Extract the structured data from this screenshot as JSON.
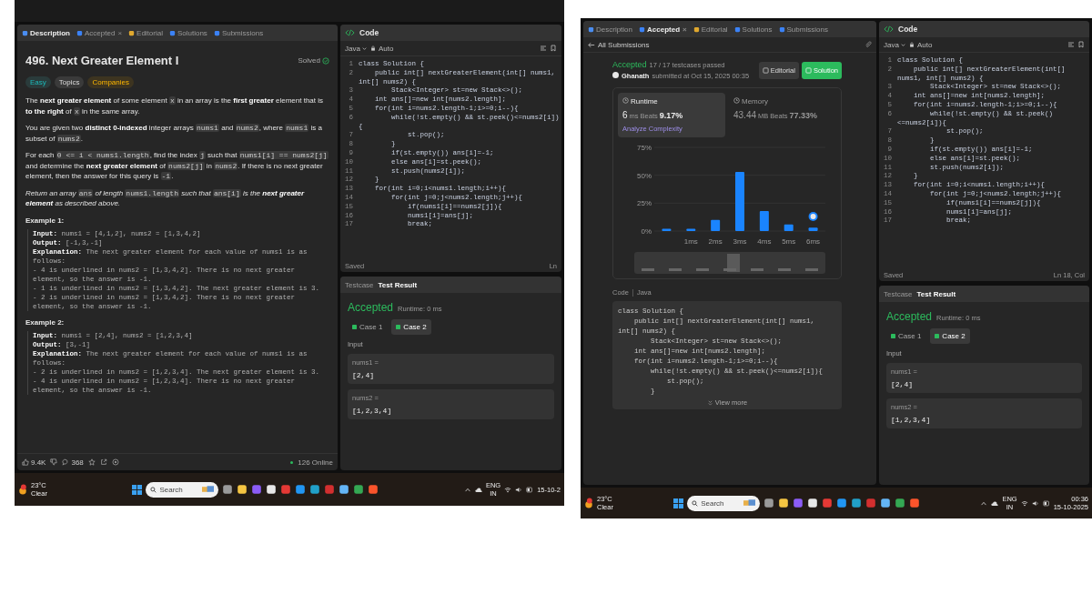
{
  "screenshots": [
    {
      "kind": "description",
      "tabs": [
        {
          "label": "Description",
          "selected": true
        },
        {
          "label": "Accepted",
          "selected": false,
          "close": "×"
        },
        {
          "label": "Editorial",
          "selected": false
        },
        {
          "label": "Solutions",
          "selected": false
        },
        {
          "label": "Submissions",
          "selected": false
        }
      ],
      "problem": {
        "title": "496. Next Greater Element I",
        "status": "Solved",
        "tags": [
          {
            "label": "Easy",
            "kind": "difficulty"
          },
          {
            "label": "Topics",
            "kind": "topics"
          },
          {
            "label": "Companies",
            "kind": "companies"
          }
        ],
        "paragraphs": [
          [
            {
              "kind": "text",
              "text": "The "
            },
            {
              "kind": "bold",
              "text": "next greater element"
            },
            {
              "kind": "text",
              "text": " of some element "
            },
            {
              "kind": "code",
              "text": "x"
            },
            {
              "kind": "text",
              "text": " in an array is the "
            },
            {
              "kind": "bold",
              "text": "first greater"
            },
            {
              "kind": "text",
              "text": " element that is "
            },
            {
              "kind": "bold",
              "text": "to the right"
            },
            {
              "kind": "text",
              "text": " of "
            },
            {
              "kind": "code",
              "text": "x"
            },
            {
              "kind": "text",
              "text": " in the same array."
            }
          ],
          [
            {
              "kind": "text",
              "text": "You are given two "
            },
            {
              "kind": "bold",
              "text": "distinct 0-indexed"
            },
            {
              "kind": "text",
              "text": " integer arrays "
            },
            {
              "kind": "code",
              "text": "nums1"
            },
            {
              "kind": "text",
              "text": " and "
            },
            {
              "kind": "code",
              "text": "nums2"
            },
            {
              "kind": "text",
              "text": ", where "
            },
            {
              "kind": "code",
              "text": "nums1"
            },
            {
              "kind": "text",
              "text": " is a subset of "
            },
            {
              "kind": "code",
              "text": "nums2"
            },
            {
              "kind": "text",
              "text": "."
            }
          ],
          [
            {
              "kind": "text",
              "text": "For each "
            },
            {
              "kind": "code",
              "text": "0 <= i < nums1.length"
            },
            {
              "kind": "text",
              "text": ", find the index "
            },
            {
              "kind": "code",
              "text": "j"
            },
            {
              "kind": "text",
              "text": " such that "
            },
            {
              "kind": "code",
              "text": "nums1[i] == nums2[j]"
            },
            {
              "kind": "text",
              "text": " and determine the "
            },
            {
              "kind": "bold",
              "text": "next greater element"
            },
            {
              "kind": "text",
              "text": " of "
            },
            {
              "kind": "code",
              "text": "nums2[j]"
            },
            {
              "kind": "text",
              "text": " in "
            },
            {
              "kind": "code",
              "text": "nums2"
            },
            {
              "kind": "text",
              "text": ". If there is no next greater element, then the answer for this query is "
            },
            {
              "kind": "code",
              "text": "-1"
            },
            {
              "kind": "text",
              "text": "."
            }
          ],
          [
            {
              "kind": "italic",
              "text": "Return an array "
            },
            {
              "kind": "code",
              "text": "ans"
            },
            {
              "kind": "italic",
              "text": " of length "
            },
            {
              "kind": "code",
              "text": "nums1.length"
            },
            {
              "kind": "italic",
              "text": " such that "
            },
            {
              "kind": "code",
              "text": "ans[i]"
            },
            {
              "kind": "italic",
              "text": " is the "
            },
            {
              "kind": "bolditalic",
              "text": "next greater element"
            },
            {
              "kind": "italic",
              "text": " as described above."
            }
          ]
        ],
        "examples": [
          {
            "title": "Example 1:",
            "lines": [
              {
                "label": "Input:",
                "text": " nums1 = [4,1,2], nums2 = [1,3,4,2]"
              },
              {
                "label": "Output:",
                "text": " [-1,3,-1]"
              },
              {
                "label": "Explanation:",
                "text": " The next greater element for each value of nums1 is as follows:"
              },
              {
                "text": "- 4 is underlined in nums2 = [1,3,4,2]. There is no next greater element, so the answer is -1."
              },
              {
                "text": "- 1 is underlined in nums2 = [1,3,4,2]. The next greater element is 3."
              },
              {
                "text": "- 2 is underlined in nums2 = [1,3,4,2]. There is no next greater element, so the answer is -1."
              }
            ]
          },
          {
            "title": "Example 2:",
            "lines": [
              {
                "label": "Input:",
                "text": " nums1 = [2,4], nums2 = [1,2,3,4]"
              },
              {
                "label": "Output:",
                "text": " [3,-1]"
              },
              {
                "label": "Explanation:",
                "text": " The next greater element for each value of nums1 is as follows:"
              },
              {
                "text": "- 2 is underlined in nums2 = [1,2,3,4]. The next greater element is 3."
              },
              {
                "text": "- 4 is underlined in nums2 = [1,2,3,4]. There is no next greater element, so the answer is -1."
              }
            ]
          }
        ],
        "likes": "9.4K",
        "comments": "368",
        "online": "126 Online"
      },
      "editor": {
        "title": "Code",
        "language": "Java",
        "mode": "Auto",
        "status": "Saved",
        "position": "Ln",
        "lines": [
          {
            "n": "1",
            "code": "class Solution {"
          },
          {
            "n": "2",
            "code": "    public int[] nextGreaterElement(int[] nums1, int[] nums2) {"
          },
          {
            "n": "3",
            "code": "        Stack<Integer> st=new Stack<>();"
          },
          {
            "n": "4",
            "code": "    int ans[]=new int[nums2.length];"
          },
          {
            "n": "5",
            "code": "    for(int i=nums2.length-1;i>=0;i--){"
          },
          {
            "n": "6",
            "code": "        while(!st.empty() && st.peek()<=nums2[i]){"
          },
          {
            "n": "7",
            "code": "            st.pop();"
          },
          {
            "n": "8",
            "code": "        }"
          },
          {
            "n": "9",
            "code": "        if(st.empty()) ans[i]=-1;"
          },
          {
            "n": "10",
            "code": "        else ans[i]=st.peek();"
          },
          {
            "n": "11",
            "code": "        st.push(nums2[i]);"
          },
          {
            "n": "12",
            "code": "    }"
          },
          {
            "n": "13",
            "code": "    for(int i=0;i<nums1.length;i++){"
          },
          {
            "n": "14",
            "code": "        for(int j=0;j<nums2.length;j++){"
          },
          {
            "n": "15",
            "code": "            if(nums1[i]==nums2[j]){"
          },
          {
            "n": "16",
            "code": "            nums1[i]=ans[j];"
          },
          {
            "n": "17",
            "code": "            break;"
          }
        ]
      },
      "result": {
        "tabs": [
          {
            "label": "Testcase",
            "selected": false
          },
          {
            "label": "Test Result",
            "selected": true
          }
        ],
        "verdict": "Accepted",
        "runtime": "Runtime: 0 ms",
        "cases": [
          {
            "label": "Case 1",
            "selected": false,
            "passed": true
          },
          {
            "label": "Case 2",
            "selected": true,
            "passed": true
          }
        ],
        "input_label": "Input",
        "inputs": [
          {
            "name": "nums1 =",
            "value": "[2,4]"
          },
          {
            "name": "nums2 =",
            "value": "[1,2,3,4]"
          }
        ]
      },
      "taskbar": {
        "temperature": "23°C",
        "weather": "Clear",
        "search": "Search",
        "language": "ENG",
        "region": "IN",
        "date": "15-10-2"
      }
    },
    {
      "kind": "submission",
      "tabs": [
        {
          "label": "Description",
          "selected": false
        },
        {
          "label": "Accepted",
          "selected": true,
          "close": "×"
        },
        {
          "label": "Editorial",
          "selected": false
        },
        {
          "label": "Solutions",
          "selected": false
        },
        {
          "label": "Submissions",
          "selected": false
        }
      ],
      "submission": {
        "back": "All Submissions",
        "verdict": "Accepted",
        "passed": "17 / 17 testcases passed",
        "user": "Ghanath",
        "submitted": "submitted at Oct 15, 2025 00:35",
        "buttons": [
          {
            "label": "Editorial",
            "kind": "secondary"
          },
          {
            "label": "Solution",
            "kind": "primary"
          }
        ],
        "metrics": [
          {
            "label": "Runtime",
            "value": "6",
            "unit": "ms",
            "beats_label": "Beats",
            "beats": "9.17%",
            "selected": true,
            "link": "Analyze Complexity"
          },
          {
            "label": "Memory",
            "value": "43.44",
            "unit": "MB",
            "beats_label": "Beats",
            "beats": "77.33%",
            "selected": false
          }
        ],
        "chart_data": {
          "type": "bar",
          "x": [
            0,
            1,
            2,
            3,
            4,
            5,
            6
          ],
          "values": [
            2,
            2,
            10,
            53,
            18,
            6,
            3
          ],
          "xlim": [
            -0.5,
            6.5
          ],
          "ylim": [
            0,
            75
          ],
          "yticks": [
            {
              "value": 0,
              "label": "0%"
            },
            {
              "value": 25,
              "label": "25%"
            },
            {
              "value": 50,
              "label": "50%"
            },
            {
              "value": 75,
              "label": "75%"
            }
          ],
          "xticks": [
            {
              "value": 1,
              "label": "1ms"
            },
            {
              "value": 2,
              "label": "2ms"
            },
            {
              "value": 3,
              "label": "3ms"
            },
            {
              "value": 4,
              "label": "4ms"
            },
            {
              "value": 5,
              "label": "5ms"
            },
            {
              "value": 6,
              "label": "6ms"
            }
          ]
        },
        "code_label": "Code",
        "code_language": "Java",
        "code": [
          "class Solution {",
          "    public int[] nextGreaterElement(int[] nums1, int[] nums2) {",
          "        Stack<Integer> st=new Stack<>();",
          "    int ans[]=new int[nums2.length];",
          "    for(int i=nums2.length-1;i>=0;i--){",
          "        while(!st.empty() && st.peek()<=nums2[i]){",
          "            st.pop();",
          "        }"
        ],
        "view_more": "View more"
      },
      "editor": {
        "title": "Code",
        "language": "Java",
        "mode": "Auto",
        "status": "Saved",
        "position": "Ln 18, Col",
        "lines": [
          {
            "n": "1",
            "code": "class Solution {"
          },
          {
            "n": "2",
            "code": "    public int[] nextGreaterElement(int[] nums1, int[] nums2) {"
          },
          {
            "n": "3",
            "code": "        Stack<Integer> st=new Stack<>();"
          },
          {
            "n": "4",
            "code": "    int ans[]=new int[nums2.length];"
          },
          {
            "n": "5",
            "code": "    for(int i=nums2.length-1;i>=0;i--){"
          },
          {
            "n": "6",
            "code": "        while(!st.empty() && st.peek()<=nums2[i]){"
          },
          {
            "n": "7",
            "code": "            st.pop();"
          },
          {
            "n": "8",
            "code": "        }"
          },
          {
            "n": "9",
            "code": "        if(st.empty()) ans[i]=-1;"
          },
          {
            "n": "10",
            "code": "        else ans[i]=st.peek();"
          },
          {
            "n": "11",
            "code": "        st.push(nums2[i]);"
          },
          {
            "n": "12",
            "code": "    }"
          },
          {
            "n": "13",
            "code": "    for(int i=0;i<nums1.length;i++){"
          },
          {
            "n": "14",
            "code": "        for(int j=0;j<nums2.length;j++){"
          },
          {
            "n": "15",
            "code": "            if(nums1[i]==nums2[j]){"
          },
          {
            "n": "16",
            "code": "            nums1[i]=ans[j];"
          },
          {
            "n": "17",
            "code": "            break;"
          }
        ]
      },
      "result": {
        "tabs": [
          {
            "label": "Testcase",
            "selected": false
          },
          {
            "label": "Test Result",
            "selected": true
          }
        ],
        "verdict": "Accepted",
        "runtime": "Runtime: 0 ms",
        "cases": [
          {
            "label": "Case 1",
            "selected": false,
            "passed": true
          },
          {
            "label": "Case 2",
            "selected": true,
            "passed": true
          }
        ],
        "input_label": "Input",
        "inputs": [
          {
            "name": "nums1 =",
            "value": "[2,4]"
          },
          {
            "name": "nums2 =",
            "value": "[1,2,3,4]"
          }
        ]
      },
      "taskbar": {
        "temperature": "23°C",
        "weather": "Clear",
        "search": "Search",
        "language": "ENG",
        "region": "IN",
        "time": "00:36",
        "date": "15-10-2025"
      }
    }
  ]
}
